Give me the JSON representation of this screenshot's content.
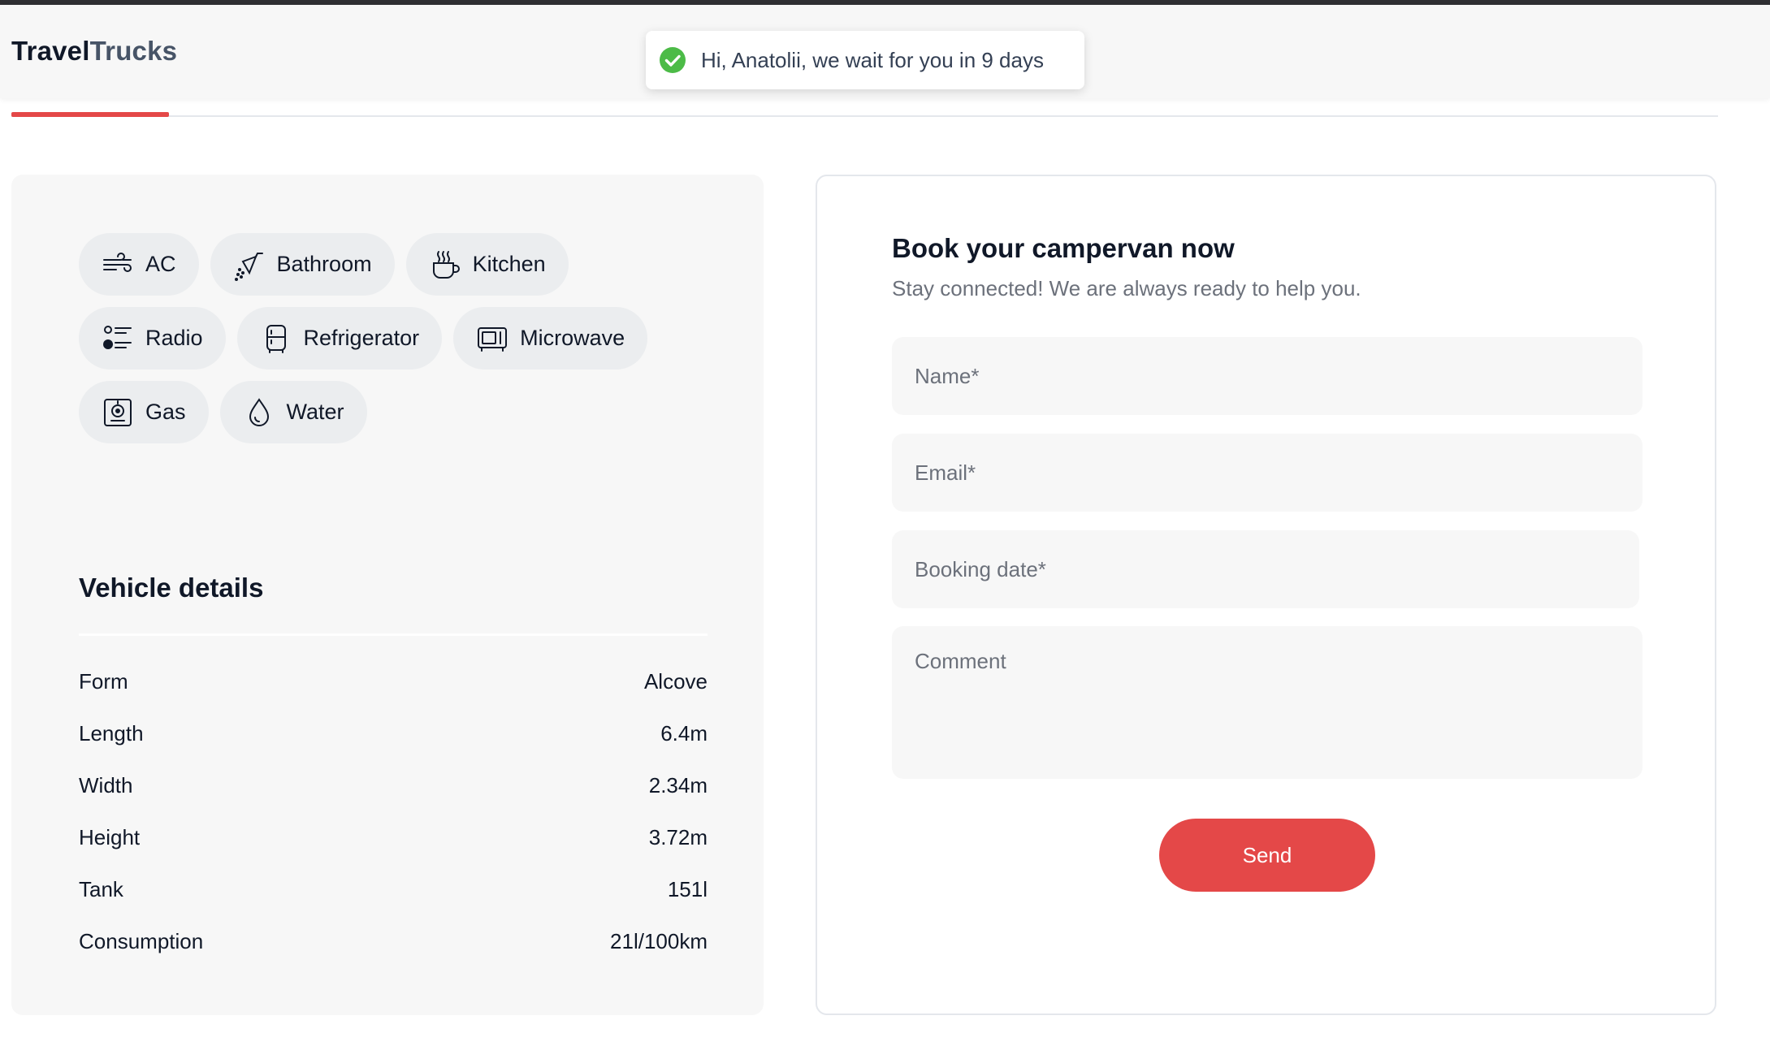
{
  "header": {
    "logo_part1": "Travel",
    "logo_part2": "Trucks"
  },
  "toast": {
    "message": "Hi, Anatolii, we wait for you in 9 days",
    "icon": "check-circle-icon",
    "color": "#4cbb47"
  },
  "colors": {
    "accent": "#e44848",
    "panel_bg": "#f7f7f7",
    "chip_bg": "#ebedef"
  },
  "features": [
    {
      "label": "AC",
      "icon": "wind-icon"
    },
    {
      "label": "Bathroom",
      "icon": "shower-icon"
    },
    {
      "label": "Kitchen",
      "icon": "cup-hot-icon"
    },
    {
      "label": "Radio",
      "icon": "radio-icon"
    },
    {
      "label": "Refrigerator",
      "icon": "fridge-icon"
    },
    {
      "label": "Microwave",
      "icon": "microwave-icon"
    },
    {
      "label": "Gas",
      "icon": "stove-icon"
    },
    {
      "label": "Water",
      "icon": "droplet-icon"
    }
  ],
  "vehicle_details": {
    "title": "Vehicle details",
    "rows": [
      {
        "label": "Form",
        "value": "Alcove"
      },
      {
        "label": "Length",
        "value": "6.4m"
      },
      {
        "label": "Width",
        "value": "2.34m"
      },
      {
        "label": "Height",
        "value": "3.72m"
      },
      {
        "label": "Tank",
        "value": "151l"
      },
      {
        "label": "Consumption",
        "value": "21l/100km"
      }
    ]
  },
  "booking": {
    "title": "Book your campervan now",
    "subtitle": "Stay connected! We are always ready to help you.",
    "name_placeholder": "Name*",
    "email_placeholder": "Email*",
    "date_placeholder": "Booking date*",
    "comment_placeholder": "Comment",
    "send_label": "Send"
  }
}
